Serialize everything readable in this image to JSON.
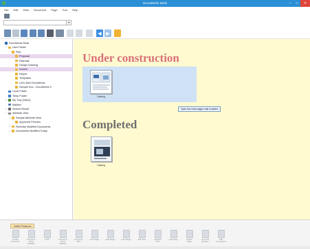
{
  "window": {
    "title": "DocuWorks Desk"
  },
  "menu": [
    "File",
    "Edit",
    "View",
    "Document",
    "Page",
    "Tool",
    "Help"
  ],
  "tree": [
    {
      "label": "DocuWorks Desk",
      "level": 0,
      "icon": "desk-icon",
      "color": "#2d6cb3",
      "expand": ""
    },
    {
      "label": "User Folder",
      "level": 1,
      "icon": "folder-icon",
      "color": "#e8b43a",
      "expand": "−"
    },
    {
      "label": "Plan",
      "level": 2,
      "icon": "folder-icon",
      "color": "#e8b43a",
      "expand": "−"
    },
    {
      "label": "Proposal",
      "level": 3,
      "icon": "folder-icon",
      "color": "#e8b43a",
      "expand": "",
      "selected": true
    },
    {
      "label": "Estimate",
      "level": 3,
      "icon": "folder-icon",
      "color": "#e8b43a",
      "expand": ""
    },
    {
      "label": "Design Drawing",
      "level": 3,
      "icon": "folder-icon",
      "color": "#e8b43a",
      "expand": ""
    },
    {
      "label": "Invoice",
      "level": 3,
      "icon": "folder-icon",
      "color": "#e8b43a",
      "expand": "",
      "selected": true
    },
    {
      "label": "Report",
      "level": 3,
      "icon": "folder-icon",
      "color": "#e8b43a",
      "expand": ""
    },
    {
      "label": "Templates",
      "level": 3,
      "icon": "folder-icon",
      "color": "#e8b43a",
      "expand": ""
    },
    {
      "label": "Let's Start DocuWorks",
      "level": 3,
      "icon": "folder-icon",
      "color": "#e8b43a",
      "expand": ""
    },
    {
      "label": "Sample Doc - DocuWorks 9",
      "level": 3,
      "icon": "folder-icon",
      "color": "#e8b43a",
      "expand": ""
    },
    {
      "label": "Local Folder",
      "level": 1,
      "icon": "folder-icon",
      "color": "#3f7fc4",
      "expand": ""
    },
    {
      "label": "Temp Folder",
      "level": 1,
      "icon": "folder-icon",
      "color": "#3f7fc4",
      "expand": ""
    },
    {
      "label": "My Tray (Inbox)",
      "level": 1,
      "icon": "tray-icon",
      "color": "#4d8a3d",
      "expand": "+"
    },
    {
      "label": "Mailbox",
      "level": 1,
      "icon": "mailbox-icon",
      "color": "#5a7fb0",
      "expand": ""
    },
    {
      "label": "Search Result",
      "level": 1,
      "icon": "search-icon",
      "color": "#6b6b6b",
      "expand": "+"
    },
    {
      "label": "Attribute View",
      "level": 1,
      "icon": "attribute-icon",
      "color": "#8b8b8b",
      "expand": "−"
    },
    {
      "label": "Sample Attribute View",
      "level": 2,
      "icon": "folder-icon",
      "color": "#e8b43a",
      "expand": "−"
    },
    {
      "label": "Approved Pictures",
      "level": 3,
      "icon": "folder-icon",
      "color": "#e8b43a",
      "expand": ""
    },
    {
      "label": "Recently Modified Documents",
      "level": 2,
      "icon": "folder-icon",
      "color": "#e8b43a",
      "expand": "+"
    },
    {
      "label": "Documents Modified Today",
      "level": 2,
      "icon": "folder-icon",
      "color": "#e8b43a",
      "expand": "+"
    }
  ],
  "sections": [
    {
      "title": "Under construction",
      "color": "#d9707a"
    },
    {
      "title": "Completed",
      "color": "#707070"
    }
  ],
  "documents": [
    {
      "label": "Catalog",
      "section": 0
    },
    {
      "label": "Catalog",
      "section": 1
    }
  ],
  "tooltip": "Open tick mark pages mail is added",
  "bottom_tab": "Useful Features",
  "features": [
    "Create Desk Item",
    "Convert to Word Editable",
    "OCR",
    "Convert to Excel Editable",
    "Convert to PDF",
    "Sort Pages",
    "Split Pages",
    "Find Pages",
    "Edit Title",
    "Highlight Text",
    "Edit Page",
    "Rotate Page",
    "Find and Replace",
    "Edit Annotations"
  ]
}
